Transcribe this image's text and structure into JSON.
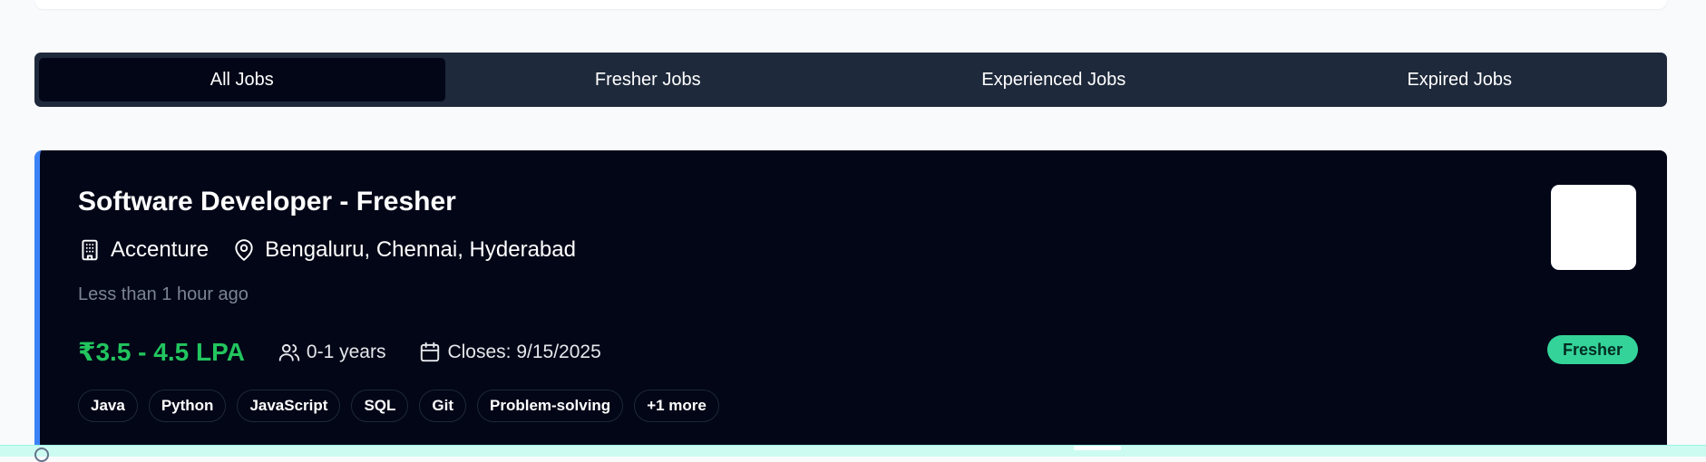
{
  "tabs": [
    {
      "label": "All Jobs",
      "active": true
    },
    {
      "label": "Fresher Jobs",
      "active": false
    },
    {
      "label": "Experienced Jobs",
      "active": false
    },
    {
      "label": "Expired Jobs",
      "active": false
    }
  ],
  "job": {
    "title": "Software Developer - Fresher",
    "company": "Accenture",
    "location": "Bengaluru, Chennai, Hyderabad",
    "posted": "Less than 1 hour ago",
    "salary": "₹3.5 - 4.5 LPA",
    "experience": "0-1 years",
    "closes": "Closes: 9/15/2025",
    "badge": "Fresher",
    "skills": [
      "Java",
      "Python",
      "JavaScript",
      "SQL",
      "Git",
      "Problem-solving"
    ],
    "more_skills": "+1 more"
  },
  "colors": {
    "accent_border": "#3b82f6",
    "salary": "#22c55e",
    "badge_bg": "#34d399",
    "card_bg": "#020617",
    "tabs_bg": "#1e293b"
  },
  "icons": {
    "company": "building-icon",
    "location": "map-pin-icon",
    "experience": "users-icon",
    "closes": "calendar-icon"
  }
}
